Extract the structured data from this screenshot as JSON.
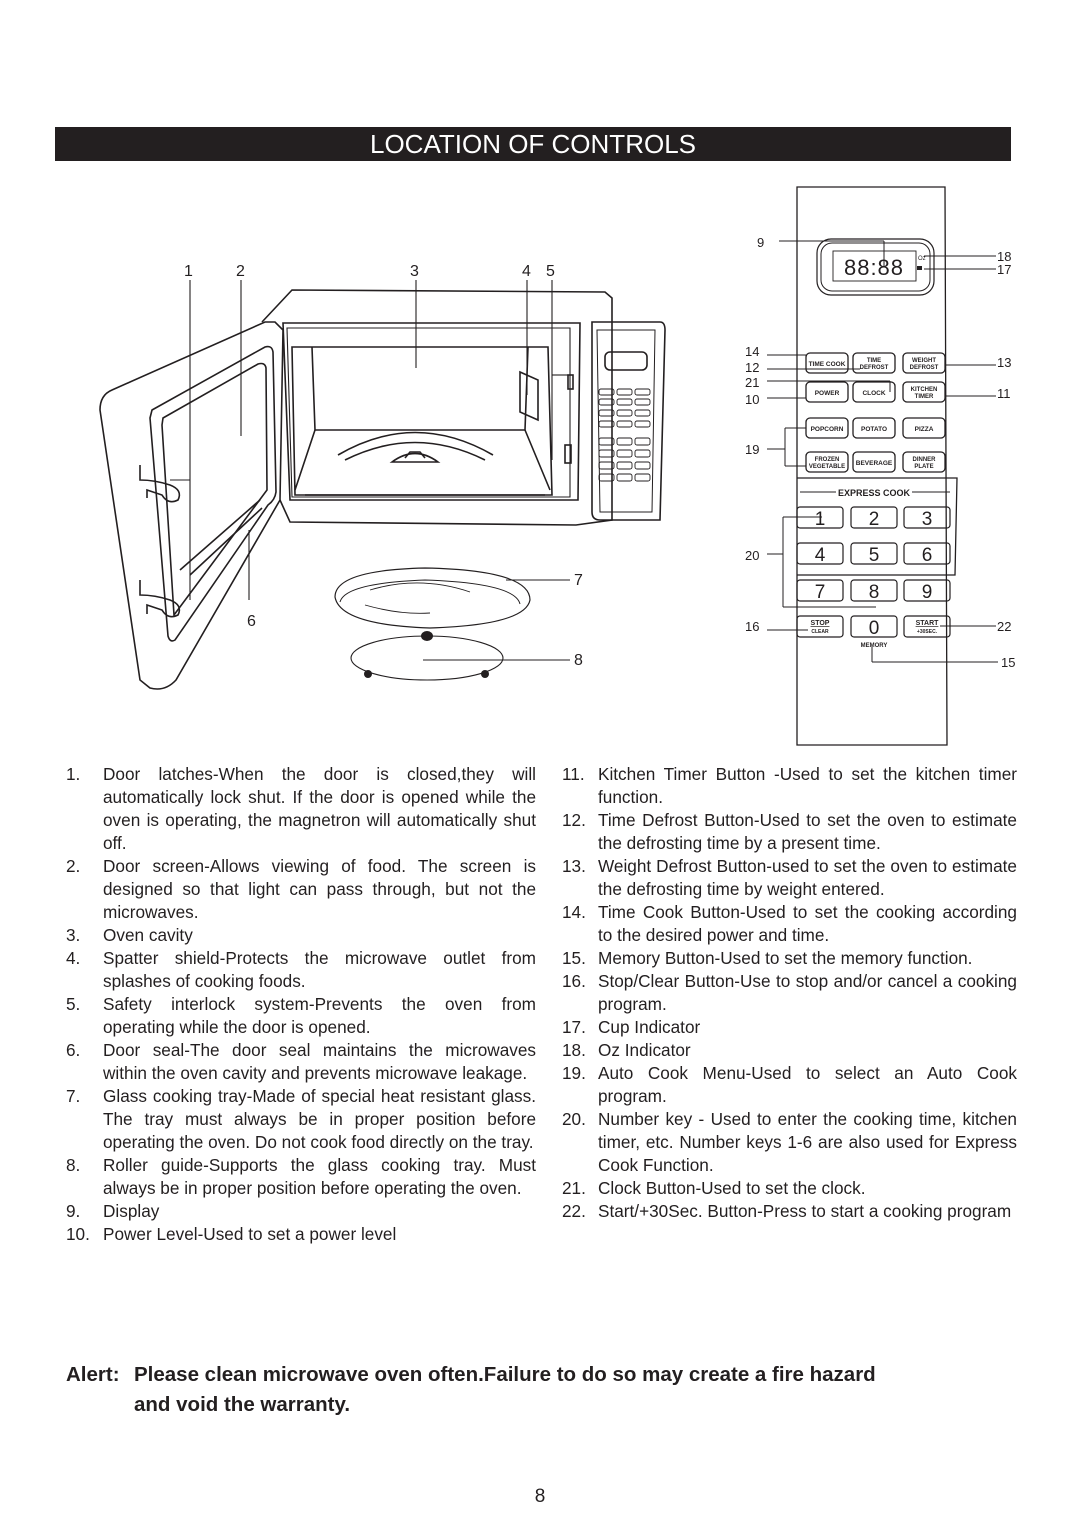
{
  "header": {
    "title": "LOCATION OF CONTROLS"
  },
  "diagram": {
    "callouts_oven": [
      "1",
      "2",
      "3",
      "4",
      "5",
      "6",
      "7",
      "8"
    ],
    "callouts_panel": [
      "9",
      "18",
      "17",
      "14",
      "12",
      "21",
      "10",
      "13",
      "11",
      "19",
      "20",
      "16",
      "22",
      "15"
    ],
    "display": {
      "digits": "88:88",
      "oz_label": "Oz"
    },
    "panel_buttons": [
      [
        "TIME COOK",
        "TIME DEFROST",
        "WEIGHT DEFROST"
      ],
      [
        "POWER",
        "CLOCK",
        "KITCHEN TIMER"
      ],
      [
        "POPCORN",
        "POTATO",
        "PIZZA"
      ],
      [
        "FROZEN VEGETABLE",
        "BEVERAGE",
        "DINNER PLATE"
      ]
    ],
    "express_cook_label": "EXPRESS COOK",
    "number_keys": [
      "1",
      "2",
      "3",
      "4",
      "5",
      "6",
      "7",
      "8",
      "9",
      "0"
    ],
    "stop_label": "STOP",
    "stop_sub": "CLEAR",
    "start_label": "START",
    "start_sub": "+30SEC.",
    "memory_label": "MEMORY"
  },
  "left_list": [
    {
      "num": "1.",
      "text": "Door latches-When the door is closed,they will automatically lock shut. If the door is opened while the oven is operating, the magnetron will automatically shut off."
    },
    {
      "num": "2.",
      "text": "Door screen-Allows viewing of food. The screen is designed so that light can pass through, but not the microwaves."
    },
    {
      "num": "3.",
      "text": "Oven cavity"
    },
    {
      "num": "4.",
      "text": "Spatter shield-Protects the microwave outlet from splashes of cooking foods."
    },
    {
      "num": "5.",
      "text": "Safety interlock system-Prevents the oven from operating while the door is opened."
    },
    {
      "num": "6.",
      "text": "Door seal-The door seal maintains the microwaves within the oven cavity and prevents microwave leakage."
    },
    {
      "num": "7.",
      "text": "Glass cooking tray-Made of special heat resistant glass. The tray must always be in proper position before operating the oven. Do not cook food directly on the tray."
    },
    {
      "num": "8.",
      "text": "Roller guide-Supports the glass cooking tray. Must always be in proper position before operating the oven."
    },
    {
      "num": "9.",
      "text": "Display"
    },
    {
      "num": "10.",
      "text": "Power Level-Used to set a power level"
    }
  ],
  "right_list": [
    {
      "num": "11.",
      "text": "Kitchen Timer Button -Used to set the kitchen timer function."
    },
    {
      "num": "12.",
      "text": "Time Defrost Button-Used to set the oven to estimate the defrosting time by a present time."
    },
    {
      "num": "13.",
      "text": "Weight Defrost Button-used to set the oven to estimate the defrosting time by weight entered."
    },
    {
      "num": "14.",
      "text": "Time Cook Button-Used to set the cooking according to the desired power and time."
    },
    {
      "num": "15.",
      "text": "Memory Button-Used to set the memory function."
    },
    {
      "num": "16.",
      "text": "Stop/Clear Button-Use to stop and/or cancel a cooking program."
    },
    {
      "num": "17.",
      "text": "Cup Indicator"
    },
    {
      "num": "18.",
      "text": "Oz Indicator"
    },
    {
      "num": "19.",
      "text": "Auto Cook Menu-Used to select an Auto Cook program."
    },
    {
      "num": "20.",
      "text": "Number key - Used to enter the cooking time, kitchen timer, etc. Number keys 1-6 are also used for Express Cook Function."
    },
    {
      "num": "21.",
      "text": "Clock Button-Used to set the clock."
    },
    {
      "num": "22.",
      "text": "Start/+30Sec. Button-Press to start a cooking program"
    }
  ],
  "alert": {
    "label": "Alert:",
    "line1": "Please clean microwave oven often.Failure to do so may create a fire hazard",
    "line2": "and void the warranty."
  },
  "footer": {
    "page_number": "8"
  }
}
